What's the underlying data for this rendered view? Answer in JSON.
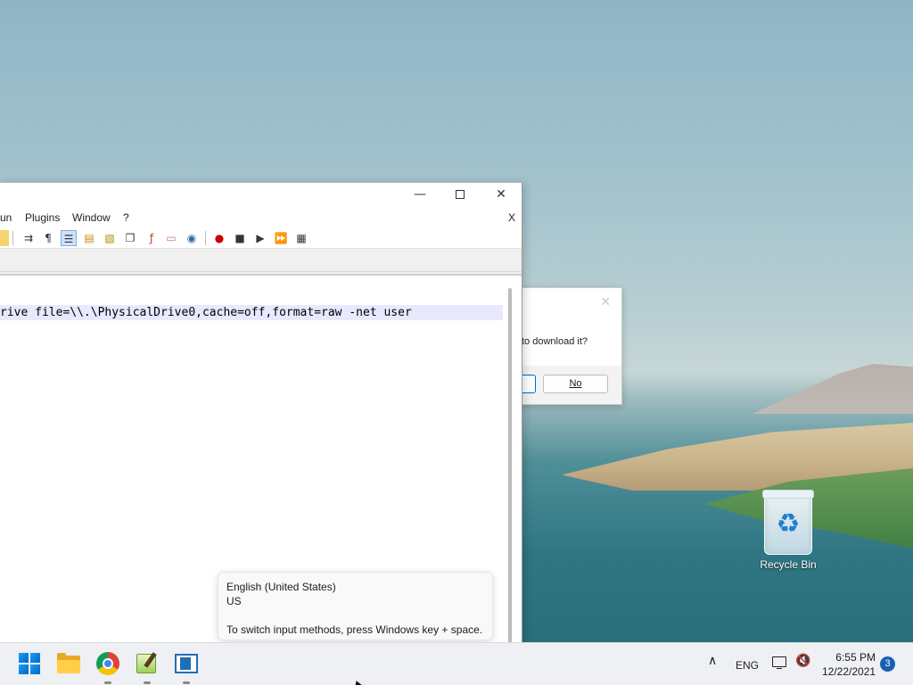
{
  "desktop": {
    "recycle_bin_label": "Recycle Bin"
  },
  "dialog": {
    "message": "to download it?",
    "no_label": "No",
    "close_glyph": "✕"
  },
  "app": {
    "window_controls": {
      "minimize": "—",
      "maximize": "",
      "close": "✕"
    },
    "menu": {
      "run": "un",
      "plugins": "Plugins",
      "window": "Window",
      "help": "?",
      "close_doc": "X"
    },
    "editor": {
      "line": "rive file=\\\\.\\PhysicalDrive0,cache=off,format=raw -net user"
    }
  },
  "ime_tooltip": {
    "language": "English (United States)",
    "layout": "US",
    "hint": "To switch input methods, press Windows key + space."
  },
  "taskbar": {
    "apps": [
      "start-menu",
      "file-explorer",
      "chrome",
      "notepad-plus-plus",
      "virtual-machine"
    ],
    "tray": {
      "chevron": "^",
      "language": "ENG",
      "time": "6:55 PM",
      "date": "12/22/2021",
      "notification_count": "3"
    }
  },
  "colors": {
    "accent": "#0067c0",
    "current_line": "#e8e8ff",
    "badge": "#1a5fb4"
  }
}
